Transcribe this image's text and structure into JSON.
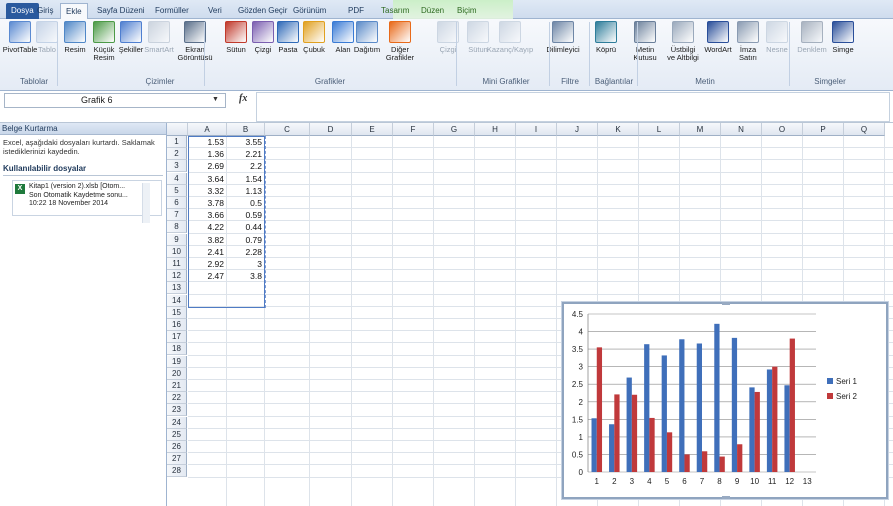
{
  "ribbon_tabs": [
    "Dosya",
    "Giriş",
    "Ekle",
    "Sayfa Düzeni",
    "Formüller",
    "Veri",
    "Gözden Geçir",
    "Görünüm",
    "PDF",
    "Tasarım",
    "Düzen",
    "Biçim"
  ],
  "ribbon": {
    "buttons": [
      {
        "label": "PivotTable",
        "sub": "",
        "icon": "pivottable-icon",
        "color": "#5b8ad1",
        "disabled": false
      },
      {
        "label": "Tablo",
        "sub": "",
        "icon": "table-icon",
        "color": "#8da9cf",
        "disabled": true
      },
      {
        "label": "Resim",
        "sub": "",
        "icon": "picture-icon",
        "color": "#4f87c7",
        "disabled": false
      },
      {
        "label": "Küçük",
        "sub": "Resim",
        "icon": "clip-art-icon",
        "color": "#4c9a47",
        "disabled": false
      },
      {
        "label": "Şekiller",
        "sub": "",
        "icon": "shapes-icon",
        "color": "#4f7fd0",
        "disabled": false
      },
      {
        "label": "SmartArt",
        "sub": "",
        "icon": "smartart-icon",
        "color": "#9aa9bc",
        "disabled": true
      },
      {
        "label": "Ekran",
        "sub": "Görüntüsü",
        "icon": "screenshot-icon",
        "color": "#5a6f8a",
        "disabled": false
      },
      {
        "label": "Sütun",
        "sub": "",
        "icon": "column-chart-icon",
        "color": "#c0392b",
        "disabled": false
      },
      {
        "label": "Çizgi",
        "sub": "",
        "icon": "line-chart-icon",
        "color": "#7b5fb0",
        "disabled": false
      },
      {
        "label": "Pasta",
        "sub": "",
        "icon": "pie-chart-icon",
        "color": "#2f6ab8",
        "disabled": false
      },
      {
        "label": "Çubuk",
        "sub": "",
        "icon": "bar-chart-icon",
        "color": "#e0a020",
        "disabled": false
      },
      {
        "label": "Alan",
        "sub": "",
        "icon": "area-chart-icon",
        "color": "#3a7bd5",
        "disabled": false
      },
      {
        "label": "Dağıtım",
        "sub": "",
        "icon": "scatter-chart-icon",
        "color": "#5a8ac8",
        "disabled": false
      },
      {
        "label": "Diğer",
        "sub": "Grafikler",
        "icon": "other-charts-icon",
        "color": "#e86a1a",
        "disabled": false
      },
      {
        "label": "Çizgi",
        "sub": "",
        "icon": "sparkline-line-icon",
        "color": "#9fb1c7",
        "disabled": true
      },
      {
        "label": "Sütun",
        "sub": "",
        "icon": "sparkline-column-icon",
        "color": "#9fb1c7",
        "disabled": true
      },
      {
        "label": "Kazanç/Kayıp",
        "sub": "",
        "icon": "win-loss-icon",
        "color": "#9fb1c7",
        "disabled": true
      },
      {
        "label": "Dilimleyici",
        "sub": "",
        "icon": "slicer-icon",
        "color": "#6e86a6",
        "disabled": false
      },
      {
        "label": "Köprü",
        "sub": "",
        "icon": "hyperlink-icon",
        "color": "#2e7d9a",
        "disabled": false
      },
      {
        "label": "Metin",
        "sub": "Kutusu",
        "icon": "text-box-icon",
        "color": "#6a7f9a",
        "disabled": false
      },
      {
        "label": "Üstbilgi",
        "sub": "ve Altbilgi",
        "icon": "header-footer-icon",
        "color": "#9aa9bc",
        "disabled": false
      },
      {
        "label": "WordArt",
        "sub": "",
        "icon": "wordart-icon",
        "color": "#2a4f9a",
        "disabled": false
      },
      {
        "label": "İmza",
        "sub": "Satırı",
        "icon": "signature-icon",
        "color": "#8a9bb2",
        "disabled": false
      },
      {
        "label": "Nesne",
        "sub": "",
        "icon": "object-icon",
        "color": "#9fb1c7",
        "disabled": true
      },
      {
        "label": "Denklem",
        "sub": "",
        "icon": "equation-icon",
        "color": "#4a5e78",
        "disabled": true
      },
      {
        "label": "Simge",
        "sub": "",
        "icon": "symbol-icon",
        "color": "#2a4f9a",
        "disabled": false
      }
    ],
    "groups": [
      "Tablolar",
      "Çizimler",
      "Grafikler",
      "Mini Grafikler",
      "Filtre",
      "Bağlantılar",
      "Metin",
      "Simgeler"
    ]
  },
  "name_box": "Grafik 6",
  "formula_label": "fx",
  "recovery": {
    "title": "Belge Kurtarma",
    "message": "Excel, aşağıdaki dosyaları kurtardı. Saklamak istediklerinizi kaydedin.",
    "available_label": "Kullanılabilir dosyalar",
    "file_name": "Kitap1 (version 2).xlsb  [Otom...",
    "file_status": "Son Otomatik Kaydetme sonu...",
    "file_time": "10:22 18 November 2014"
  },
  "columns": [
    "A",
    "B",
    "C",
    "D",
    "E",
    "F",
    "G",
    "H",
    "I",
    "J",
    "K",
    "L",
    "M",
    "N",
    "O",
    "P",
    "Q"
  ],
  "rows": [
    "1",
    "2",
    "3",
    "4",
    "5",
    "6",
    "7",
    "8",
    "9",
    "10",
    "11",
    "12",
    "13",
    "14",
    "15",
    "16",
    "17",
    "18",
    "19",
    "20",
    "21",
    "22",
    "23",
    "24",
    "25",
    "26",
    "27",
    "28"
  ],
  "sheet_data": [
    [
      "1.53",
      "3.55"
    ],
    [
      "1.36",
      "2.21"
    ],
    [
      "2.69",
      "2.2"
    ],
    [
      "3.64",
      "1.54"
    ],
    [
      "3.32",
      "1.13"
    ],
    [
      "3.78",
      "0.5"
    ],
    [
      "3.66",
      "0.59"
    ],
    [
      "4.22",
      "0.44"
    ],
    [
      "3.82",
      "0.79"
    ],
    [
      "2.41",
      "2.28"
    ],
    [
      "2.92",
      "3"
    ],
    [
      "2.47",
      "3.8"
    ]
  ],
  "chart_data": {
    "type": "bar",
    "categories": [
      "1",
      "2",
      "3",
      "4",
      "5",
      "6",
      "7",
      "8",
      "9",
      "10",
      "11",
      "12",
      "13"
    ],
    "series": [
      {
        "name": "Seri 1",
        "color": "#3f6fba",
        "values": [
          1.53,
          1.36,
          2.69,
          3.64,
          3.32,
          3.78,
          3.66,
          4.22,
          3.82,
          2.41,
          2.92,
          2.47
        ]
      },
      {
        "name": "Seri 2",
        "color": "#c0393b",
        "values": [
          3.55,
          2.21,
          2.2,
          1.54,
          1.13,
          0.5,
          0.59,
          0.44,
          0.79,
          2.28,
          3,
          3.8
        ]
      }
    ],
    "ylim": [
      0,
      4.5
    ],
    "yticks": [
      "0",
      "0.5",
      "1",
      "1.5",
      "2",
      "2.5",
      "3",
      "3.5",
      "4",
      "4.5"
    ],
    "grid": true,
    "legend_position": "right"
  }
}
